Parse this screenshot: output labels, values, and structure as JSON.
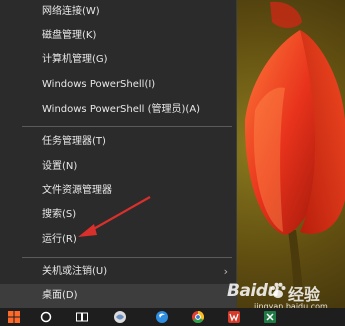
{
  "menu": {
    "items": [
      {
        "label": "网络连接(W)"
      },
      {
        "label": "磁盘管理(K)"
      },
      {
        "label": "计算机管理(G)"
      },
      {
        "label": "Windows PowerShell(I)"
      },
      {
        "label": "Windows PowerShell (管理员)(A)"
      },
      {
        "label": "任务管理器(T)"
      },
      {
        "label": "设置(N)"
      },
      {
        "label": "文件资源管理器"
      },
      {
        "label": "搜索(S)"
      },
      {
        "label": "运行(R)"
      },
      {
        "label": "关机或注销(U)",
        "submenu_icon": "chevron-right-icon"
      },
      {
        "label": "桌面(D)"
      }
    ]
  },
  "watermark": {
    "brand": "Baidu",
    "cn": "经验",
    "url": "jingyan.baidu.com"
  },
  "taskbar": {
    "icons": [
      "windows-start-icon",
      "search-icon",
      "task-view-icon",
      "app-icon",
      "browser-icon",
      "chrome-icon",
      "wps-icon",
      "excel-icon"
    ]
  },
  "colors": {
    "menu_bg": "#2b2b2b",
    "menu_text": "#e8e8e8",
    "highlight": "#3d3d3d",
    "arrow": "#d9302c"
  }
}
